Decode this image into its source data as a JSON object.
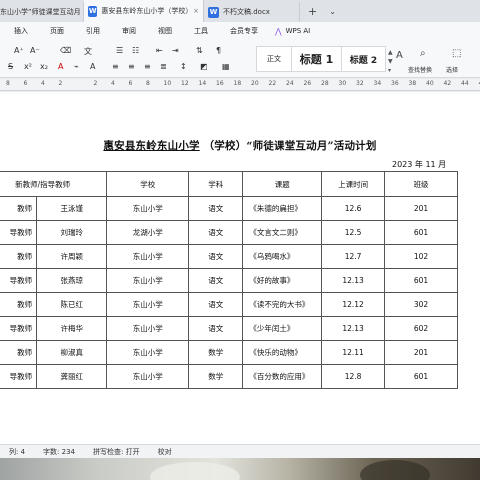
{
  "tabs": [
    {
      "label": "东山小学”师徒课堂互动月",
      "active": false,
      "width": 84
    },
    {
      "label": "惠安县东岭东山小学（学校）“师",
      "active": true,
      "width": 120
    },
    {
      "label": "不朽文稿.docx",
      "active": false,
      "width": 96
    }
  ],
  "tab_add": "+",
  "tab_more": "⌄",
  "menu": [
    "插入",
    "页面",
    "引用",
    "审阅",
    "视图",
    "工具",
    "会员专享"
  ],
  "wps_ai": "WPS AI",
  "ribbon": {
    "styles": {
      "normal": "正文",
      "h1": "标题 1",
      "h2": "标题 2"
    },
    "find_replace": "查找替换",
    "select": "选择"
  },
  "ruler": [
    "8",
    "6",
    "4",
    "2",
    "",
    "2",
    "4",
    "6",
    "8",
    "10",
    "12",
    "14",
    "16",
    "18",
    "20",
    "22",
    "24",
    "26",
    "28",
    "30",
    "32",
    "34",
    "36",
    "38",
    "40",
    "42",
    "44",
    "46"
  ],
  "document": {
    "title_underlined": "惠安县东岭东山小学",
    "title_rest": "（学校）“师徒课堂互动月”活动计划",
    "date": "2023 年 11 月",
    "headers": [
      "新教师/指导教师",
      "学校",
      "学科",
      "课题",
      "上课时间",
      "班级"
    ],
    "rows": [
      {
        "role": "教师",
        "name": "王泳馑",
        "school": "东山小学",
        "subject": "语文",
        "topic": "《朱德的扁担》",
        "time": "12.6",
        "class": "201"
      },
      {
        "role": "导教师",
        "name": "刘瑞玲",
        "school": "龙湖小学",
        "subject": "语文",
        "topic": "《文言文二则》",
        "time": "12.5",
        "class": "601"
      },
      {
        "role": "教师",
        "name": "许周颖",
        "school": "东山小学",
        "subject": "语文",
        "topic": "《乌鸦喝水》",
        "time": "12.7",
        "class": "102"
      },
      {
        "role": "导教师",
        "name": "张燕琼",
        "school": "东山小学",
        "subject": "语文",
        "topic": "《好的故事》",
        "time": "12.13",
        "class": "601"
      },
      {
        "role": "教师",
        "name": "陈已红",
        "school": "东山小学",
        "subject": "语文",
        "topic": "《读不完的大书》",
        "time": "12.12",
        "class": "302"
      },
      {
        "role": "导教师",
        "name": "许梅华",
        "school": "东山小学",
        "subject": "语文",
        "topic": "《少年闰土》",
        "time": "12.13",
        "class": "602"
      },
      {
        "role": "教师",
        "name": "柳淑真",
        "school": "东山小学",
        "subject": "数学",
        "topic": "《快乐的动物》",
        "time": "12.11",
        "class": "201"
      },
      {
        "role": "导教师",
        "name": "龚丽红",
        "school": "东山小学",
        "subject": "数学",
        "topic": "《百分数的应用》",
        "time": "12.8",
        "class": "601"
      }
    ]
  },
  "status": {
    "col": "列: 4",
    "words": "字数: 234",
    "spell": "拼写检查: 打开",
    "proof": "校对"
  }
}
